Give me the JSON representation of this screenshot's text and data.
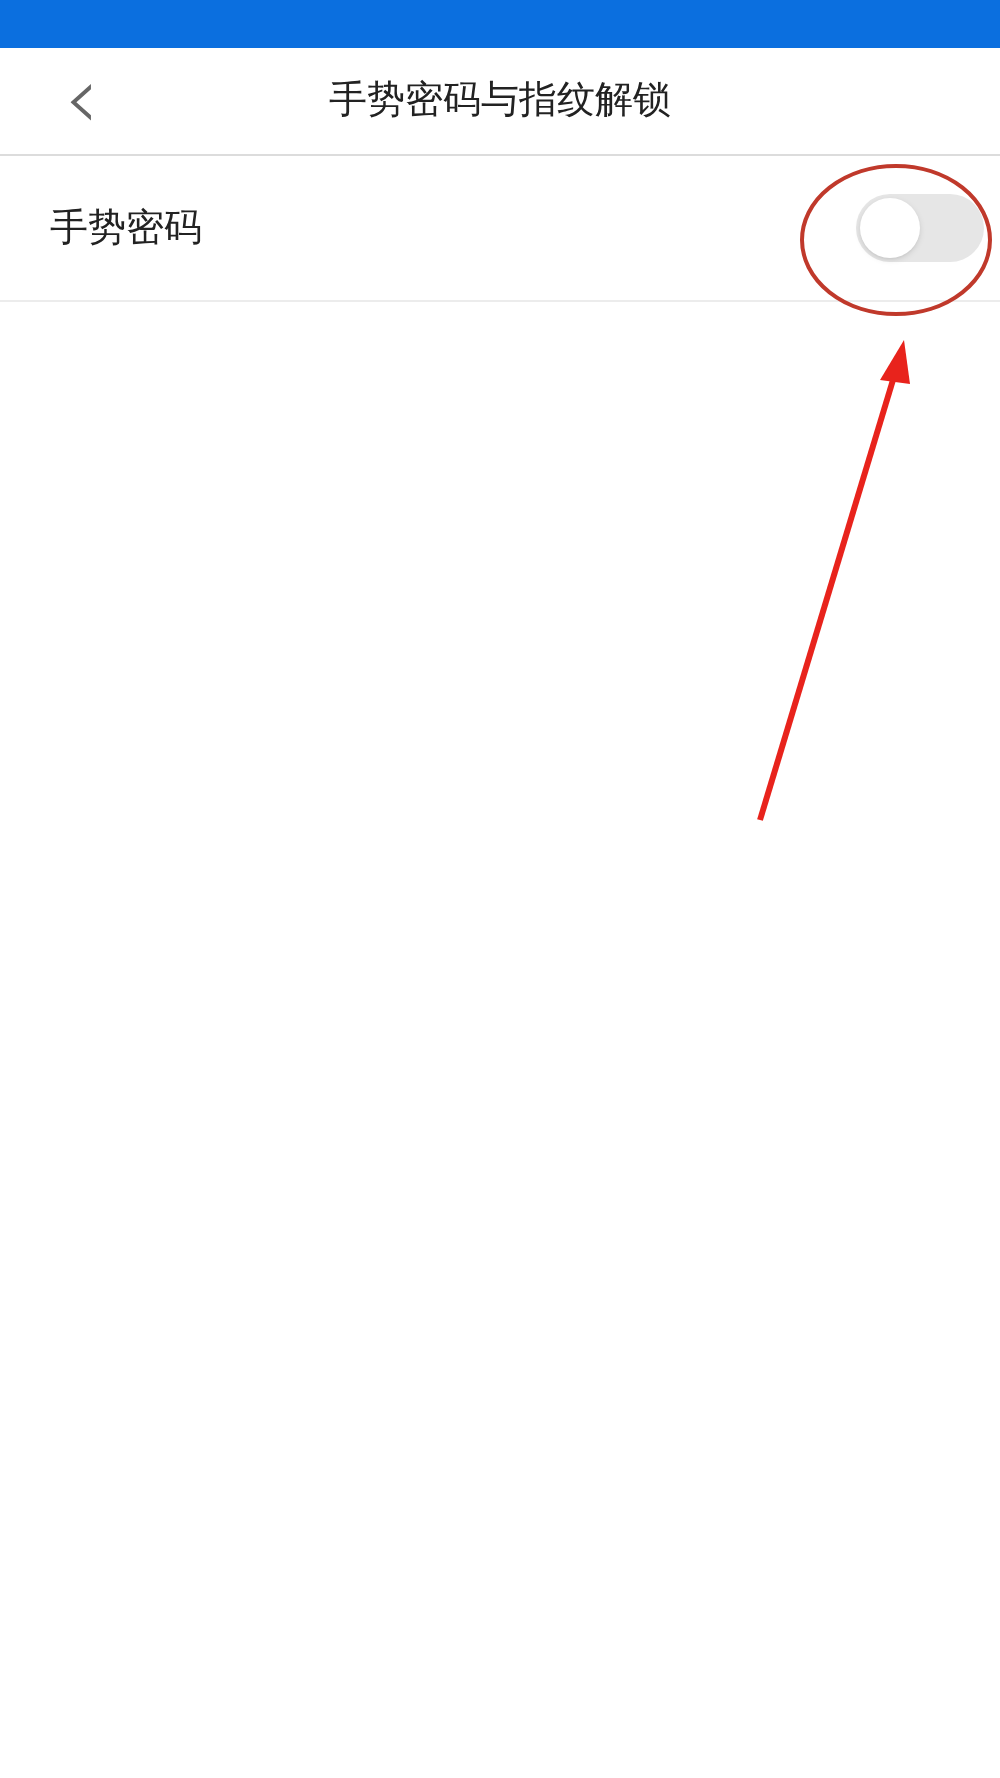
{
  "nav_bar": {
    "back": "‹",
    "title": "手势密码与指纹解锁"
  },
  "settings": [
    {
      "label": "手势密码",
      "on": false
    }
  ]
}
